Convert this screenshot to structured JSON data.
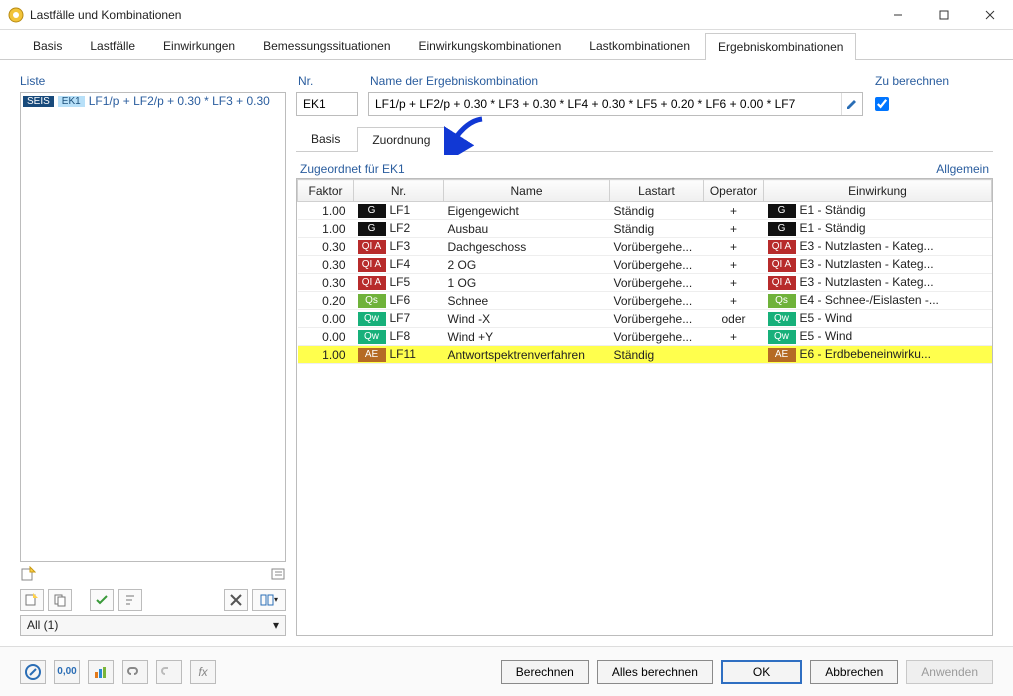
{
  "window": {
    "title": "Lastfälle und Kombinationen"
  },
  "tabs": {
    "basis": "Basis",
    "lastfaelle": "Lastfälle",
    "einwirkungen": "Einwirkungen",
    "bemessung": "Bemessungssituationen",
    "einwkomb": "Einwirkungskombinationen",
    "lastkomb": "Lastkombinationen",
    "ergebnis": "Ergebniskombinationen"
  },
  "list": {
    "header": "Liste",
    "items": [
      {
        "tag": "SEIS",
        "ek": "EK1",
        "text": "LF1/p + LF2/p + 0.30 * LF3 + 0.30"
      }
    ],
    "filter": "All (1)"
  },
  "fields": {
    "nr_label": "Nr.",
    "nr_value": "EK1",
    "name_label": "Name der Ergebniskombination",
    "name_value": "LF1/p + LF2/p + 0.30 * LF3 + 0.30 * LF4 + 0.30 * LF5 + 0.20 * LF6 + 0.00 * LF7",
    "calc_label": "Zu berechnen",
    "calc_checked": true
  },
  "subtabs": {
    "basis": "Basis",
    "zuordnung": "Zuordnung"
  },
  "assigned": {
    "title": "Zugeordnet für EK1",
    "allgemein": "Allgemein",
    "cols": {
      "faktor": "Faktor",
      "nr": "Nr.",
      "name": "Name",
      "lastart": "Lastart",
      "operator": "Operator",
      "einwirkung": "Einwirkung"
    },
    "rows": [
      {
        "faktor": "1.00",
        "badge": "G",
        "badge_cls": "b-G",
        "lf": "LF1",
        "name": "Eigengewicht",
        "lastart": "Ständig",
        "op": "+",
        "ein_badge": "G",
        "ein_cls": "b-G",
        "ein": "E1 - Ständig",
        "hl": false
      },
      {
        "faktor": "1.00",
        "badge": "G",
        "badge_cls": "b-G",
        "lf": "LF2",
        "name": "Ausbau",
        "lastart": "Ständig",
        "op": "+",
        "ein_badge": "G",
        "ein_cls": "b-G",
        "ein": "E1 - Ständig",
        "hl": false
      },
      {
        "faktor": "0.30",
        "badge": "QI A",
        "badge_cls": "b-QIA",
        "lf": "LF3",
        "name": "Dachgeschoss",
        "lastart": "Vorübergehe...",
        "op": "+",
        "ein_badge": "QI A",
        "ein_cls": "b-QIA",
        "ein": "E3 - Nutzlasten - Kateg...",
        "hl": false
      },
      {
        "faktor": "0.30",
        "badge": "QI A",
        "badge_cls": "b-QIA",
        "lf": "LF4",
        "name": "2 OG",
        "lastart": "Vorübergehe...",
        "op": "+",
        "ein_badge": "QI A",
        "ein_cls": "b-QIA",
        "ein": "E3 - Nutzlasten - Kateg...",
        "hl": false
      },
      {
        "faktor": "0.30",
        "badge": "QI A",
        "badge_cls": "b-QIA",
        "lf": "LF5",
        "name": "1 OG",
        "lastart": "Vorübergehe...",
        "op": "+",
        "ein_badge": "QI A",
        "ein_cls": "b-QIA",
        "ein": "E3 - Nutzlasten - Kateg...",
        "hl": false
      },
      {
        "faktor": "0.20",
        "badge": "Qs",
        "badge_cls": "b-Qs",
        "lf": "LF6",
        "name": "Schnee",
        "lastart": "Vorübergehe...",
        "op": "+",
        "ein_badge": "Qs",
        "ein_cls": "b-Qs",
        "ein": "E4 - Schnee-/Eislasten -...",
        "hl": false
      },
      {
        "faktor": "0.00",
        "badge": "Qw",
        "badge_cls": "b-Qw",
        "lf": "LF7",
        "name": "Wind -X",
        "lastart": "Vorübergehe...",
        "op": "oder",
        "ein_badge": "Qw",
        "ein_cls": "b-Qw",
        "ein": "E5 - Wind",
        "hl": false
      },
      {
        "faktor": "0.00",
        "badge": "Qw",
        "badge_cls": "b-Qw",
        "lf": "LF8",
        "name": "Wind +Y",
        "lastart": "Vorübergehe...",
        "op": "+",
        "ein_badge": "Qw",
        "ein_cls": "b-Qw",
        "ein": "E5 - Wind",
        "hl": false
      },
      {
        "faktor": "1.00",
        "badge": "AE",
        "badge_cls": "b-AE",
        "lf": "LF11",
        "name": "Antwortspektrenverfahren",
        "lastart": "Ständig",
        "op": "",
        "ein_badge": "AE",
        "ein_cls": "b-AE",
        "ein": "E6 - Erdbebeneinwirku...",
        "hl": true
      }
    ]
  },
  "footer": {
    "berechnen": "Berechnen",
    "alles": "Alles berechnen",
    "ok": "OK",
    "abbrechen": "Abbrechen",
    "anwenden": "Anwenden"
  }
}
